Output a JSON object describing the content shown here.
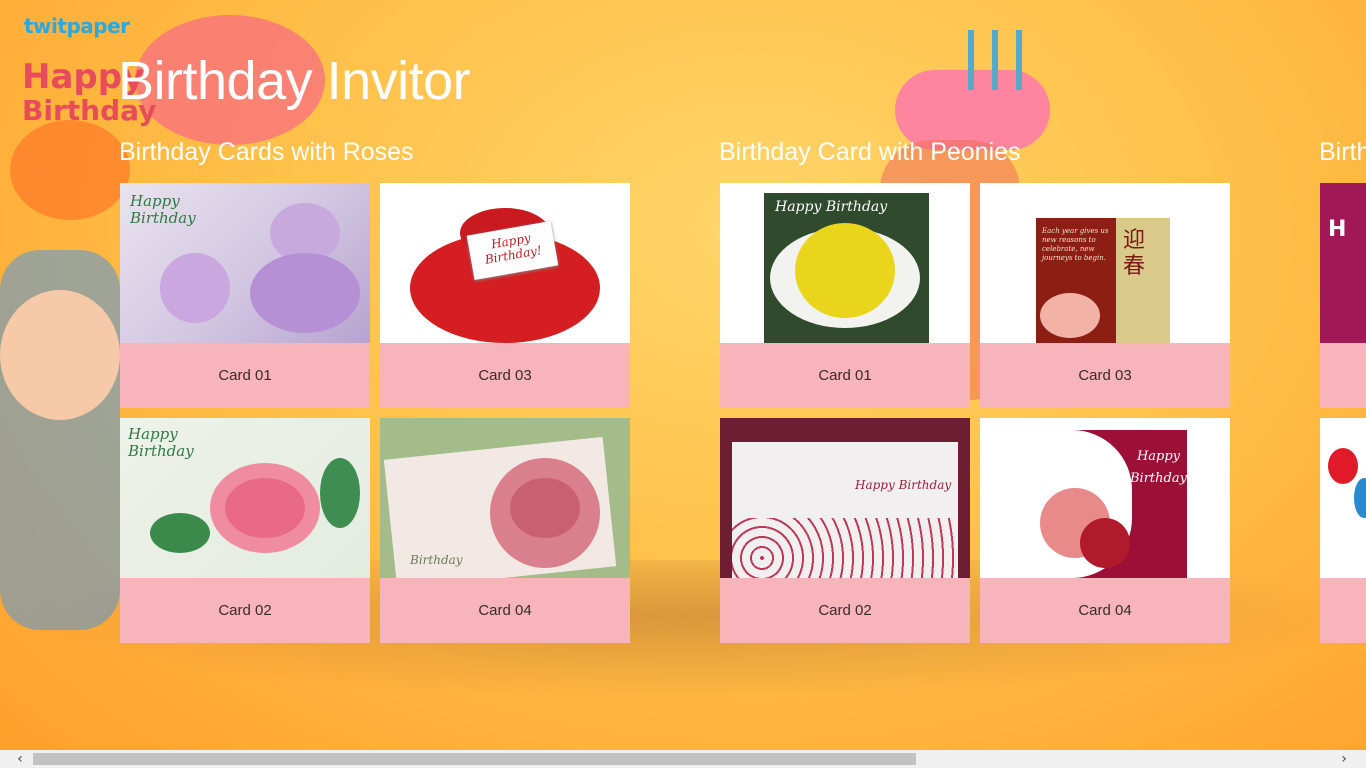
{
  "app": {
    "title": "Birthday Invitor",
    "logo": "twitpaper",
    "bg_text_1": "Happy",
    "bg_text_2": "Birthday"
  },
  "groups": [
    {
      "title": "Birthday Cards with Roses",
      "cards": [
        {
          "label": "Card 01"
        },
        {
          "label": "Card 03"
        },
        {
          "label": "Card 02"
        },
        {
          "label": "Card 04"
        }
      ]
    },
    {
      "title": "Birthday Card with Peonies",
      "cards": [
        {
          "label": "Card 01"
        },
        {
          "label": "Card 03"
        },
        {
          "label": "Card 02"
        },
        {
          "label": "Card 04"
        }
      ]
    },
    {
      "title": "Birth"
    }
  ],
  "card_texts": {
    "happy": "Happy",
    "birthday": "Birthday",
    "happy_birthday": "Happy Birthday",
    "happy_birthday_bang": "Happy Birthday!",
    "chinese": "迎春",
    "h": "H",
    "peony_note": "Each year gives us new reasons to celebrate, new journeys to begin."
  },
  "scroll": {
    "left_arrow": "‹",
    "right_arrow": "›"
  },
  "colors": {
    "caption_bg": "#f6acb2",
    "background": "#ffc14a"
  }
}
